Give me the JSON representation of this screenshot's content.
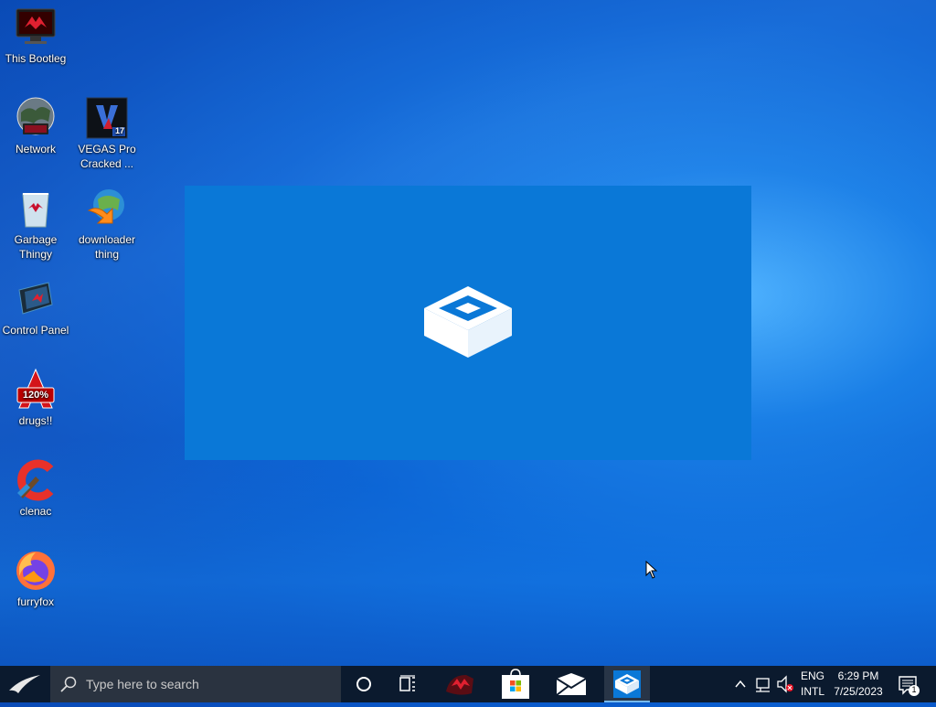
{
  "desktop": {
    "icons": [
      {
        "label": "This Bootleg",
        "icon": "computer-icon"
      },
      {
        "label": "Network",
        "icon": "network-icon"
      },
      {
        "label": "VEGAS Pro Cracked ...",
        "icon": "vegas-pro-icon",
        "badge": "17"
      },
      {
        "label": "Garbage Thingy",
        "icon": "recycle-bin-icon"
      },
      {
        "label": "downloader thing",
        "icon": "download-manager-icon"
      },
      {
        "label": "Control Panel",
        "icon": "control-panel-icon"
      },
      {
        "label": "drugs!!",
        "icon": "acrobat-icon",
        "badge": "120%"
      },
      {
        "label": "clenac",
        "icon": "ccleaner-icon"
      },
      {
        "label": "furryfox",
        "icon": "firefox-icon"
      }
    ]
  },
  "splash": {
    "icon": "sandbox-box-icon",
    "color": "#0a78d7"
  },
  "taskbar": {
    "search_placeholder": "Type here to search",
    "apps": [
      {
        "name": "cortana",
        "icon": "cortana-circle-icon"
      },
      {
        "name": "task-view",
        "icon": "task-view-icon"
      },
      {
        "name": "rog-app",
        "icon": "rog-app-icon"
      },
      {
        "name": "store",
        "icon": "store-icon"
      },
      {
        "name": "mail",
        "icon": "mail-icon"
      },
      {
        "name": "sandbox",
        "icon": "sandbox-icon",
        "active": true
      }
    ],
    "tray": {
      "lang_line1": "ENG",
      "lang_line2": "INTL",
      "time": "6:29 PM",
      "date": "7/25/2023",
      "notifications": "1"
    }
  }
}
